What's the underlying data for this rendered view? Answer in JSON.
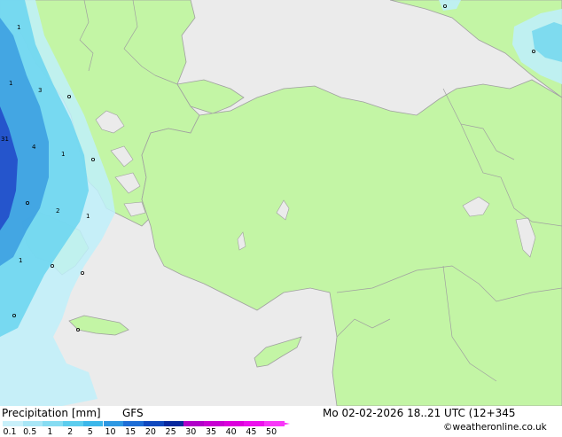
{
  "header": {
    "title": "Precipitation [mm]",
    "model": "GFS",
    "datetime": "Mo 02-02-2026 18..21 UTC (12+345",
    "credit": "©weatheronline.co.uk"
  },
  "legend": {
    "ticks": [
      "0.1",
      "0.5",
      "1",
      "2",
      "5",
      "10",
      "15",
      "20",
      "25",
      "30",
      "35",
      "40",
      "45",
      "50"
    ],
    "colors": [
      "#c8f0fa",
      "#a8e6f6",
      "#86dcf2",
      "#5ccdee",
      "#3cb7ea",
      "#2e98e2",
      "#1e6ed6",
      "#1048be",
      "#08289e",
      "#b000c8",
      "#c800d2",
      "#dc00dc",
      "#ec10ec",
      "#f838f8"
    ]
  },
  "colors": {
    "land": "#c3f5a5",
    "sea": "#ebebeb",
    "border": "#a0a0a0",
    "precip_light": "#bff0fa",
    "precip_med": "#6ed6ef",
    "precip_heavy": "#3a9ce0",
    "precip_vheavy": "#2046c8"
  },
  "map_labels": [
    "1",
    "1",
    "3",
    "4",
    "1",
    "31",
    "2",
    "1",
    "1"
  ]
}
